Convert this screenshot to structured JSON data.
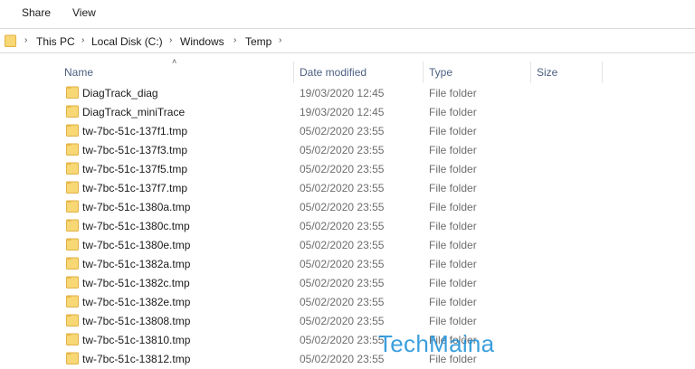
{
  "ribbon": {
    "tabs": [
      "Share",
      "View"
    ]
  },
  "address": {
    "crumbs": [
      "This PC",
      "Local Disk (C:)",
      "Windows",
      "Temp"
    ],
    "folder_icon": "folder-icon",
    "separator_icon": "chevron-right-icon"
  },
  "columns": {
    "name": "Name",
    "date_modified": "Date modified",
    "type": "Type",
    "size": "Size",
    "sort_icon": "sort-ascending-icon"
  },
  "files": [
    {
      "name": "DiagTrack_diag",
      "date": "19/03/2020 12:45",
      "type": "File folder"
    },
    {
      "name": "DiagTrack_miniTrace",
      "date": "19/03/2020 12:45",
      "type": "File folder"
    },
    {
      "name": "tw-7bc-51c-137f1.tmp",
      "date": "05/02/2020 23:55",
      "type": "File folder"
    },
    {
      "name": "tw-7bc-51c-137f3.tmp",
      "date": "05/02/2020 23:55",
      "type": "File folder"
    },
    {
      "name": "tw-7bc-51c-137f5.tmp",
      "date": "05/02/2020 23:55",
      "type": "File folder"
    },
    {
      "name": "tw-7bc-51c-137f7.tmp",
      "date": "05/02/2020 23:55",
      "type": "File folder"
    },
    {
      "name": "tw-7bc-51c-1380a.tmp",
      "date": "05/02/2020 23:55",
      "type": "File folder"
    },
    {
      "name": "tw-7bc-51c-1380c.tmp",
      "date": "05/02/2020 23:55",
      "type": "File folder"
    },
    {
      "name": "tw-7bc-51c-1380e.tmp",
      "date": "05/02/2020 23:55",
      "type": "File folder"
    },
    {
      "name": "tw-7bc-51c-1382a.tmp",
      "date": "05/02/2020 23:55",
      "type": "File folder"
    },
    {
      "name": "tw-7bc-51c-1382c.tmp",
      "date": "05/02/2020 23:55",
      "type": "File folder"
    },
    {
      "name": "tw-7bc-51c-1382e.tmp",
      "date": "05/02/2020 23:55",
      "type": "File folder"
    },
    {
      "name": "tw-7bc-51c-13808.tmp",
      "date": "05/02/2020 23:55",
      "type": "File folder"
    },
    {
      "name": "tw-7bc-51c-13810.tmp",
      "date": "05/02/2020 23:55",
      "type": "File folder"
    },
    {
      "name": "tw-7bc-51c-13812.tmp",
      "date": "05/02/2020 23:55",
      "type": "File folder"
    }
  ],
  "watermark": "TechMaina",
  "colors": {
    "folder_fill": "#f8d775",
    "folder_tab": "#e8b84a",
    "header_text": "#4d6082",
    "watermark": "#1a8fd8"
  }
}
